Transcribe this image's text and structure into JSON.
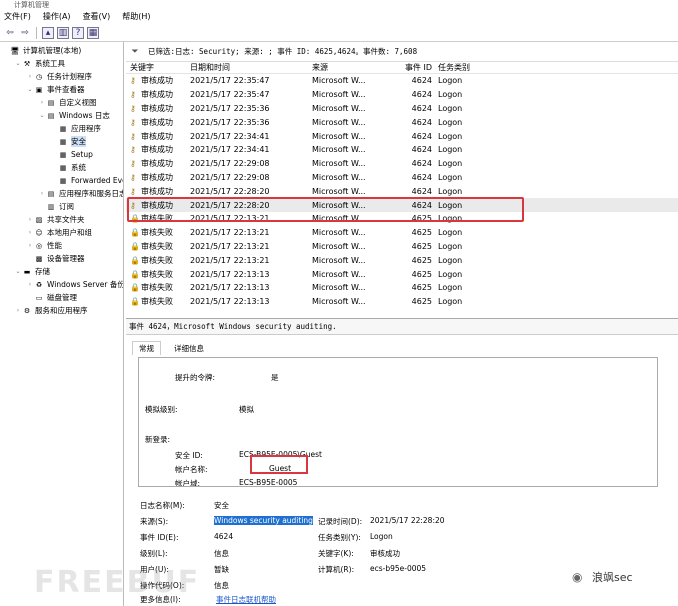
{
  "window": {
    "title": "计算机管理"
  },
  "menu": [
    "文件(F)",
    "操作(A)",
    "查看(V)",
    "帮助(H)"
  ],
  "tree": [
    {
      "label": "计算机管理(本地)",
      "arrow": "",
      "icon": "computer-icon",
      "glyph": "🖥",
      "indent": 0
    },
    {
      "label": "系统工具",
      "arrow": "⌄",
      "icon": "tools-icon",
      "glyph": "⚒",
      "indent": 1
    },
    {
      "label": "任务计划程序",
      "arrow": "›",
      "icon": "clock-icon",
      "glyph": "◷",
      "indent": 2
    },
    {
      "label": "事件查看器",
      "arrow": "⌄",
      "icon": "event-viewer-icon",
      "glyph": "▣",
      "indent": 2
    },
    {
      "label": "自定义视图",
      "arrow": "›",
      "icon": "folder-icon",
      "glyph": "▤",
      "indent": 3
    },
    {
      "label": "Windows 日志",
      "arrow": "⌄",
      "icon": "folder-icon",
      "glyph": "▤",
      "indent": 3
    },
    {
      "label": "应用程序",
      "arrow": "",
      "icon": "log-icon",
      "glyph": "▦",
      "indent": 4
    },
    {
      "label": "安全",
      "arrow": "",
      "icon": "log-icon",
      "glyph": "▦",
      "indent": 4,
      "selected": true
    },
    {
      "label": "Setup",
      "arrow": "",
      "icon": "log-icon",
      "glyph": "▦",
      "indent": 4
    },
    {
      "label": "系统",
      "arrow": "",
      "icon": "log-icon",
      "glyph": "▦",
      "indent": 4
    },
    {
      "label": "Forwarded Eve",
      "arrow": "",
      "icon": "log-icon",
      "glyph": "▦",
      "indent": 4
    },
    {
      "label": "应用程序和服务日志",
      "arrow": "›",
      "icon": "folder-icon",
      "glyph": "▤",
      "indent": 3
    },
    {
      "label": "订阅",
      "arrow": "",
      "icon": "subscription-icon",
      "glyph": "▥",
      "indent": 3
    },
    {
      "label": "共享文件夹",
      "arrow": "›",
      "icon": "shared-folder-icon",
      "glyph": "▨",
      "indent": 2
    },
    {
      "label": "本地用户和组",
      "arrow": "›",
      "icon": "users-icon",
      "glyph": "☺",
      "indent": 2
    },
    {
      "label": "性能",
      "arrow": "›",
      "icon": "performance-icon",
      "glyph": "◎",
      "indent": 2
    },
    {
      "label": "设备管理器",
      "arrow": "",
      "icon": "device-manager-icon",
      "glyph": "▩",
      "indent": 2
    },
    {
      "label": "存储",
      "arrow": "⌄",
      "icon": "storage-icon",
      "glyph": "▬",
      "indent": 1
    },
    {
      "label": "Windows Server 备份",
      "arrow": "›",
      "icon": "backup-icon",
      "glyph": "♻",
      "indent": 2
    },
    {
      "label": "磁盘管理",
      "arrow": "",
      "icon": "disk-icon",
      "glyph": "▭",
      "indent": 2
    },
    {
      "label": "服务和应用程序",
      "arrow": "›",
      "icon": "services-icon",
      "glyph": "⚙",
      "indent": 1
    }
  ],
  "events": {
    "filter": "已筛选:日志: Security; 来源: ; 事件 ID: 4625,4624。事件数: 7,608",
    "columns": [
      "关键字",
      "日期和时间",
      "来源",
      "事件 ID",
      "任务类别"
    ],
    "rows": [
      [
        "审核成功",
        "2021/5/17 22:35:47",
        "Microsoft W...",
        "4624",
        "Logon"
      ],
      [
        "审核成功",
        "2021/5/17 22:35:47",
        "Microsoft W...",
        "4624",
        "Logon"
      ],
      [
        "审核成功",
        "2021/5/17 22:35:36",
        "Microsoft W...",
        "4624",
        "Logon"
      ],
      [
        "审核成功",
        "2021/5/17 22:35:36",
        "Microsoft W...",
        "4624",
        "Logon"
      ],
      [
        "审核成功",
        "2021/5/17 22:34:41",
        "Microsoft W...",
        "4624",
        "Logon"
      ],
      [
        "审核成功",
        "2021/5/17 22:34:41",
        "Microsoft W...",
        "4624",
        "Logon"
      ],
      [
        "审核成功",
        "2021/5/17 22:29:08",
        "Microsoft W...",
        "4624",
        "Logon"
      ],
      [
        "审核成功",
        "2021/5/17 22:29:08",
        "Microsoft W...",
        "4624",
        "Logon"
      ],
      [
        "审核成功",
        "2021/5/17 22:28:20",
        "Microsoft W...",
        "4624",
        "Logon"
      ],
      [
        "审核成功",
        "2021/5/17 22:28:20",
        "Microsoft W...",
        "4624",
        "Logon"
      ],
      [
        "审核失败",
        "2021/5/17 22:13:21",
        "Microsoft W...",
        "4625",
        "Logon"
      ],
      [
        "审核失败",
        "2021/5/17 22:13:21",
        "Microsoft W...",
        "4625",
        "Logon"
      ],
      [
        "审核失败",
        "2021/5/17 22:13:21",
        "Microsoft W...",
        "4625",
        "Logon"
      ],
      [
        "审核失败",
        "2021/5/17 22:13:21",
        "Microsoft W...",
        "4625",
        "Logon"
      ],
      [
        "审核失败",
        "2021/5/17 22:13:13",
        "Microsoft W...",
        "4625",
        "Logon"
      ],
      [
        "审核失败",
        "2021/5/17 22:13:13",
        "Microsoft W...",
        "4625",
        "Logon"
      ],
      [
        "审核失败",
        "2021/5/17 22:13:13",
        "Microsoft W...",
        "4625",
        "Logon"
      ]
    ],
    "selected_row": 9
  },
  "detail": {
    "title": "事件 4624，Microsoft Windows security auditing.",
    "tabs": [
      "常规",
      "详细信息"
    ],
    "desc": {
      "elevated_label": "提升的令牌:",
      "elevated_value": "是",
      "impersonation_label": "模拟级别:",
      "impersonation_value": "模拟",
      "newlogon_label": "新登录:",
      "secid_label": "安全 ID:",
      "secid_value": "ECS-B95E-0005\\Guest",
      "account_label": "帐户名称:",
      "account_value": "Guest",
      "domain_label": "帐户域:",
      "domain_value": "ECS-B95E-0005"
    },
    "props": {
      "logname_label": "日志名称(M):",
      "logname_value": "安全",
      "source_label": "来源(S):",
      "source_value": "Windows security auditing",
      "recorded_label": "记录时间(D):",
      "recorded_value": "2021/5/17 22:28:20",
      "eventid_label": "事件 ID(E):",
      "eventid_value": "4624",
      "category_label": "任务类别(Y):",
      "category_value": "Logon",
      "level_label": "级别(L):",
      "level_value": "信息",
      "keywords_label": "关键字(K):",
      "keywords_value": "审核成功",
      "user_label": "用户(U):",
      "user_value": "暂缺",
      "computer_label": "计算机(R):",
      "computer_value": "ecs-b95e-0005",
      "opcode_label": "操作代码(O):",
      "opcode_value": "信息",
      "more_label": "更多信息(I):",
      "more_link": "事件日志联机帮助"
    }
  },
  "watermark": {
    "left": "FREEBUF",
    "right": "浪飒sec"
  },
  "colors": {
    "highlight": "#d9363e",
    "selection": "#1e6fd0",
    "link": "#1a56c9"
  }
}
